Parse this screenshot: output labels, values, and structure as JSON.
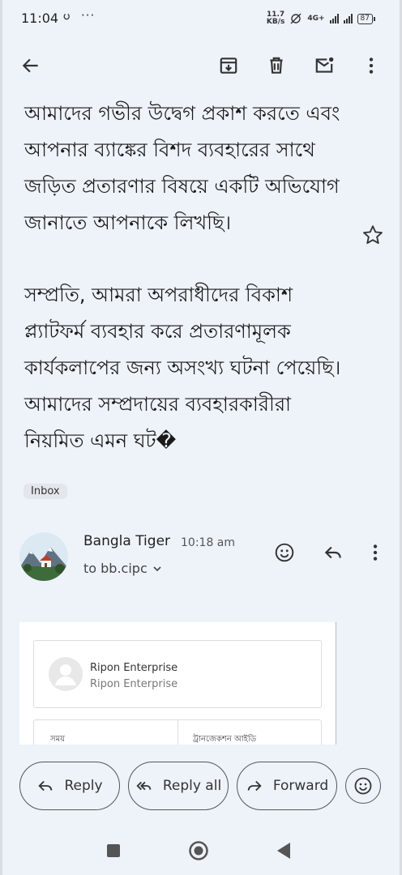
{
  "status_bar": {
    "time": "11:04",
    "notif_glyph": "ပ",
    "more": "···",
    "net_speed_value": "11.7",
    "net_speed_unit": "KB/s",
    "network_type": "4G+",
    "battery": "87"
  },
  "app_bar": {
    "back_icon": "arrow-back-icon",
    "archive_icon": "archive-icon",
    "delete_icon": "delete-icon",
    "mark_unread_icon": "mark-unread-icon",
    "more_icon": "more-vert-icon"
  },
  "message": {
    "paragraph_1": "আমাদের গভীর উদ্বেগ প্রকাশ করতে এবং আপনার ব্যাঙ্কের বিশদ ব্যবহারের সাথে জড়িত প্রতারণার বিষয়ে একটি অভিযোগ জানাতে আপনাকে লিখছি।",
    "paragraph_2": "সম্প্রতি, আমরা অপরাধীদের বিকাশ প্ল্যাটফর্ম ব্যবহার করে প্রতারণামূলক কার্যকলাপের জন্য অসংখ্য ঘটনা পেয়েছি। আমাদের সম্প্রদায়ের ব্যবহারকারীরা নিয়মিত এমন ঘট�",
    "label": "Inbox"
  },
  "sender": {
    "name": "Bangla Tiger",
    "time": "10:18 am",
    "to": "to bb.cipc"
  },
  "receipt": {
    "merchant_name": "Ripon Enterprise",
    "merchant_sub": "Ripon Enterprise",
    "col_time": "সময়",
    "col_txn_id": "ট্রানজেকশন আইডি"
  },
  "actions": {
    "reply": "Reply",
    "reply_all": "Reply all",
    "forward": "Forward"
  },
  "colors": {
    "background": "#eef3fa",
    "text": "#1f1f1f",
    "border": "#555555"
  }
}
